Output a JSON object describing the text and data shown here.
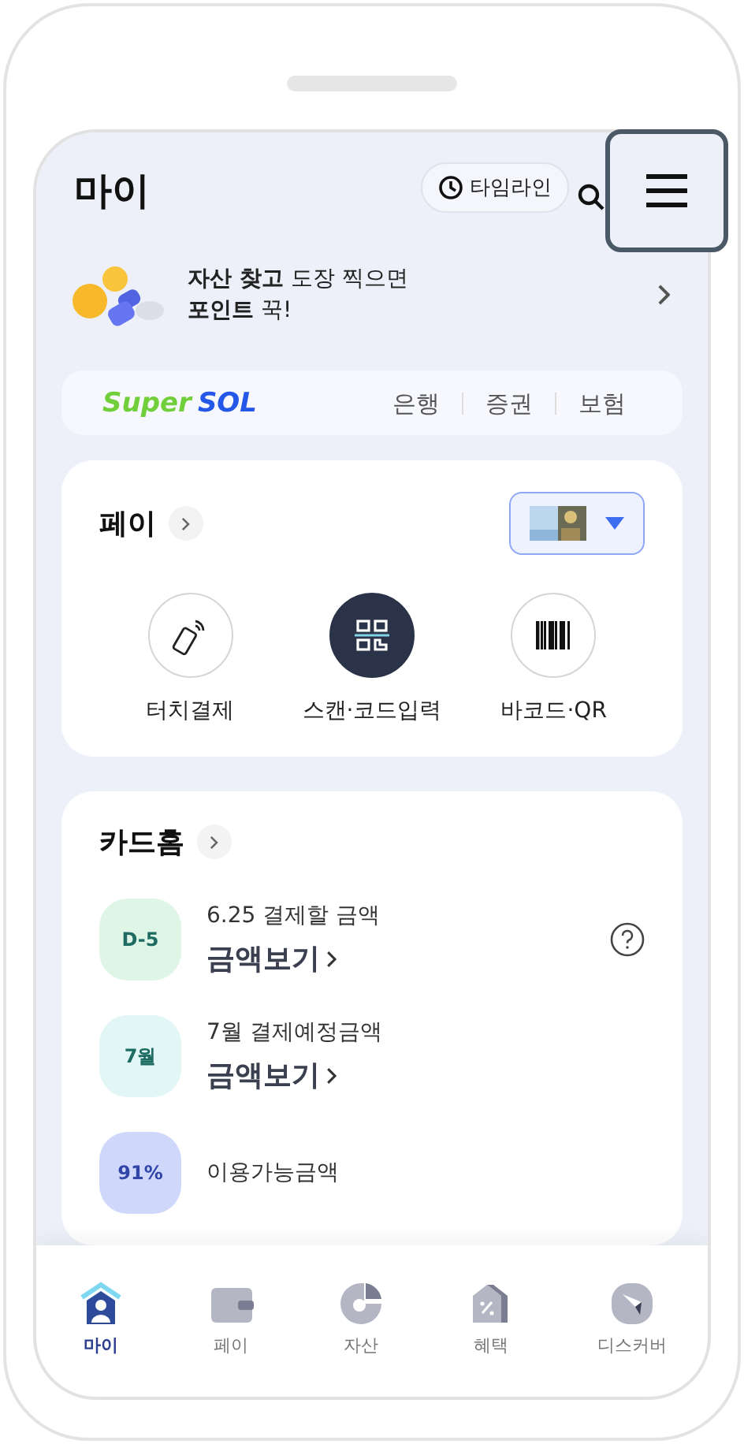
{
  "header": {
    "title": "마이",
    "timeline_button": "타임라인",
    "menu_highlighted": true
  },
  "banner": {
    "text": "**자산 찾고** 도장 찍으면\n**포인트** 꾹!"
  },
  "supersol": {
    "logo_super": "Super",
    "logo_sol": "SOL",
    "links": [
      "은행",
      "증권",
      "보험"
    ]
  },
  "pay": {
    "title": "페이",
    "actions": [
      {
        "kind": "touch",
        "label": "터치결제",
        "selected": false
      },
      {
        "kind": "scan",
        "label": "스캔·코드입력",
        "selected": true
      },
      {
        "kind": "barcode",
        "label": "바코드·QR",
        "selected": false
      }
    ]
  },
  "card_home": {
    "title": "카드홈",
    "rows": [
      {
        "badge": "D-5",
        "color": "#dff5e6",
        "caption": "6.25 결제할 금액",
        "action": "금액보기",
        "help": true
      },
      {
        "badge": "7월",
        "color": "#e2f6f6",
        "caption": "7월 결제예정금액",
        "action": "금액보기",
        "help": false
      },
      {
        "badge": "91%",
        "color": "#cfd8fb",
        "caption": "이용가능금액",
        "help": false
      }
    ]
  },
  "bottom_nav": [
    {
      "kind": "my",
      "label": "마이",
      "selected": true
    },
    {
      "kind": "pay",
      "label": "페이",
      "selected": false
    },
    {
      "kind": "asset",
      "label": "자산",
      "selected": false
    },
    {
      "kind": "benefit",
      "label": "혜택",
      "selected": false
    },
    {
      "kind": "discover",
      "label": "디스커버",
      "selected": false
    }
  ]
}
